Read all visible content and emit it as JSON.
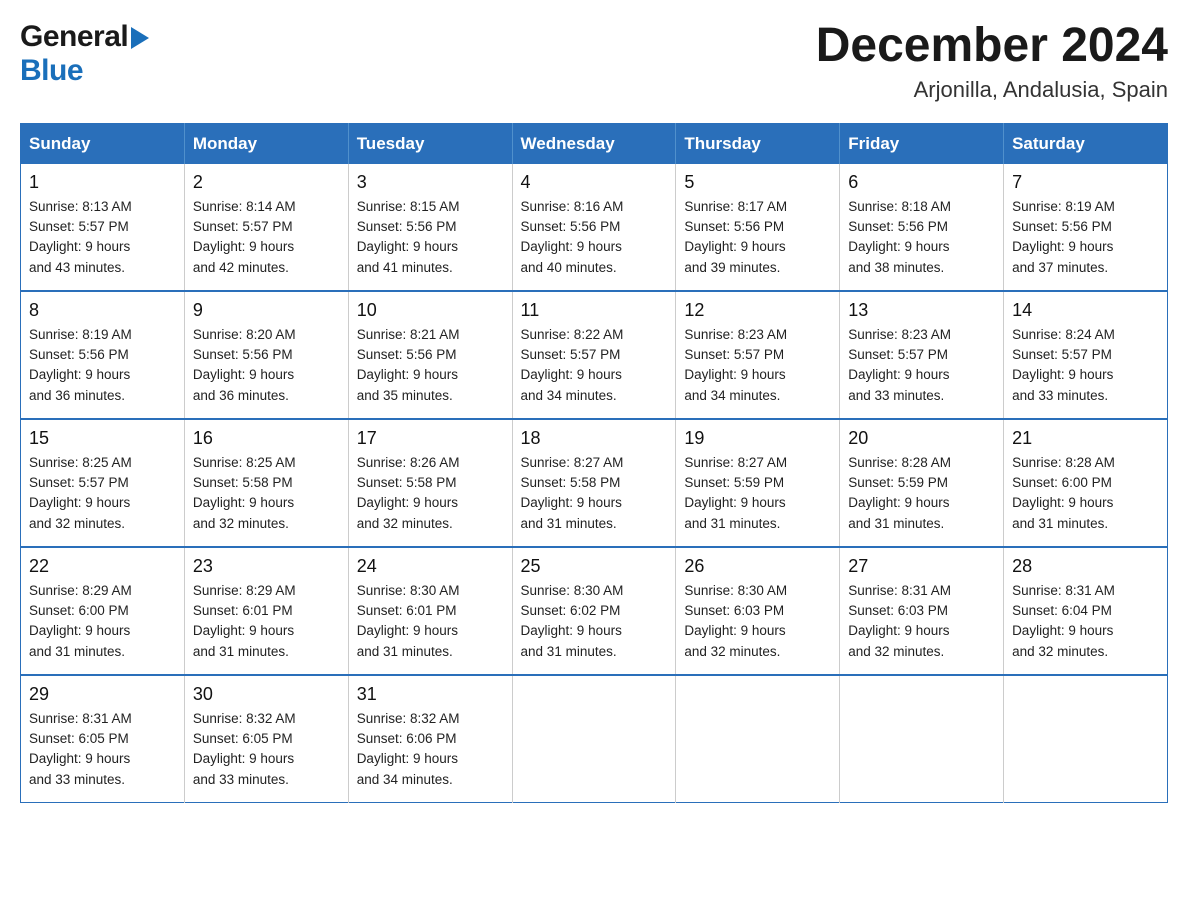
{
  "header": {
    "logo": {
      "general": "General",
      "blue": "Blue",
      "triangle_color": "#1a6fba"
    },
    "title": "December 2024",
    "location": "Arjonilla, Andalusia, Spain"
  },
  "calendar": {
    "days_of_week": [
      "Sunday",
      "Monday",
      "Tuesday",
      "Wednesday",
      "Thursday",
      "Friday",
      "Saturday"
    ],
    "weeks": [
      [
        {
          "day": "1",
          "sunrise": "8:13 AM",
          "sunset": "5:57 PM",
          "daylight": "9 hours and 43 minutes."
        },
        {
          "day": "2",
          "sunrise": "8:14 AM",
          "sunset": "5:57 PM",
          "daylight": "9 hours and 42 minutes."
        },
        {
          "day": "3",
          "sunrise": "8:15 AM",
          "sunset": "5:56 PM",
          "daylight": "9 hours and 41 minutes."
        },
        {
          "day": "4",
          "sunrise": "8:16 AM",
          "sunset": "5:56 PM",
          "daylight": "9 hours and 40 minutes."
        },
        {
          "day": "5",
          "sunrise": "8:17 AM",
          "sunset": "5:56 PM",
          "daylight": "9 hours and 39 minutes."
        },
        {
          "day": "6",
          "sunrise": "8:18 AM",
          "sunset": "5:56 PM",
          "daylight": "9 hours and 38 minutes."
        },
        {
          "day": "7",
          "sunrise": "8:19 AM",
          "sunset": "5:56 PM",
          "daylight": "9 hours and 37 minutes."
        }
      ],
      [
        {
          "day": "8",
          "sunrise": "8:19 AM",
          "sunset": "5:56 PM",
          "daylight": "9 hours and 36 minutes."
        },
        {
          "day": "9",
          "sunrise": "8:20 AM",
          "sunset": "5:56 PM",
          "daylight": "9 hours and 36 minutes."
        },
        {
          "day": "10",
          "sunrise": "8:21 AM",
          "sunset": "5:56 PM",
          "daylight": "9 hours and 35 minutes."
        },
        {
          "day": "11",
          "sunrise": "8:22 AM",
          "sunset": "5:57 PM",
          "daylight": "9 hours and 34 minutes."
        },
        {
          "day": "12",
          "sunrise": "8:23 AM",
          "sunset": "5:57 PM",
          "daylight": "9 hours and 34 minutes."
        },
        {
          "day": "13",
          "sunrise": "8:23 AM",
          "sunset": "5:57 PM",
          "daylight": "9 hours and 33 minutes."
        },
        {
          "day": "14",
          "sunrise": "8:24 AM",
          "sunset": "5:57 PM",
          "daylight": "9 hours and 33 minutes."
        }
      ],
      [
        {
          "day": "15",
          "sunrise": "8:25 AM",
          "sunset": "5:57 PM",
          "daylight": "9 hours and 32 minutes."
        },
        {
          "day": "16",
          "sunrise": "8:25 AM",
          "sunset": "5:58 PM",
          "daylight": "9 hours and 32 minutes."
        },
        {
          "day": "17",
          "sunrise": "8:26 AM",
          "sunset": "5:58 PM",
          "daylight": "9 hours and 32 minutes."
        },
        {
          "day": "18",
          "sunrise": "8:27 AM",
          "sunset": "5:58 PM",
          "daylight": "9 hours and 31 minutes."
        },
        {
          "day": "19",
          "sunrise": "8:27 AM",
          "sunset": "5:59 PM",
          "daylight": "9 hours and 31 minutes."
        },
        {
          "day": "20",
          "sunrise": "8:28 AM",
          "sunset": "5:59 PM",
          "daylight": "9 hours and 31 minutes."
        },
        {
          "day": "21",
          "sunrise": "8:28 AM",
          "sunset": "6:00 PM",
          "daylight": "9 hours and 31 minutes."
        }
      ],
      [
        {
          "day": "22",
          "sunrise": "8:29 AM",
          "sunset": "6:00 PM",
          "daylight": "9 hours and 31 minutes."
        },
        {
          "day": "23",
          "sunrise": "8:29 AM",
          "sunset": "6:01 PM",
          "daylight": "9 hours and 31 minutes."
        },
        {
          "day": "24",
          "sunrise": "8:30 AM",
          "sunset": "6:01 PM",
          "daylight": "9 hours and 31 minutes."
        },
        {
          "day": "25",
          "sunrise": "8:30 AM",
          "sunset": "6:02 PM",
          "daylight": "9 hours and 31 minutes."
        },
        {
          "day": "26",
          "sunrise": "8:30 AM",
          "sunset": "6:03 PM",
          "daylight": "9 hours and 32 minutes."
        },
        {
          "day": "27",
          "sunrise": "8:31 AM",
          "sunset": "6:03 PM",
          "daylight": "9 hours and 32 minutes."
        },
        {
          "day": "28",
          "sunrise": "8:31 AM",
          "sunset": "6:04 PM",
          "daylight": "9 hours and 32 minutes."
        }
      ],
      [
        {
          "day": "29",
          "sunrise": "8:31 AM",
          "sunset": "6:05 PM",
          "daylight": "9 hours and 33 minutes."
        },
        {
          "day": "30",
          "sunrise": "8:32 AM",
          "sunset": "6:05 PM",
          "daylight": "9 hours and 33 minutes."
        },
        {
          "day": "31",
          "sunrise": "8:32 AM",
          "sunset": "6:06 PM",
          "daylight": "9 hours and 34 minutes."
        },
        null,
        null,
        null,
        null
      ]
    ],
    "labels": {
      "sunrise": "Sunrise:",
      "sunset": "Sunset:",
      "daylight": "Daylight:"
    }
  }
}
